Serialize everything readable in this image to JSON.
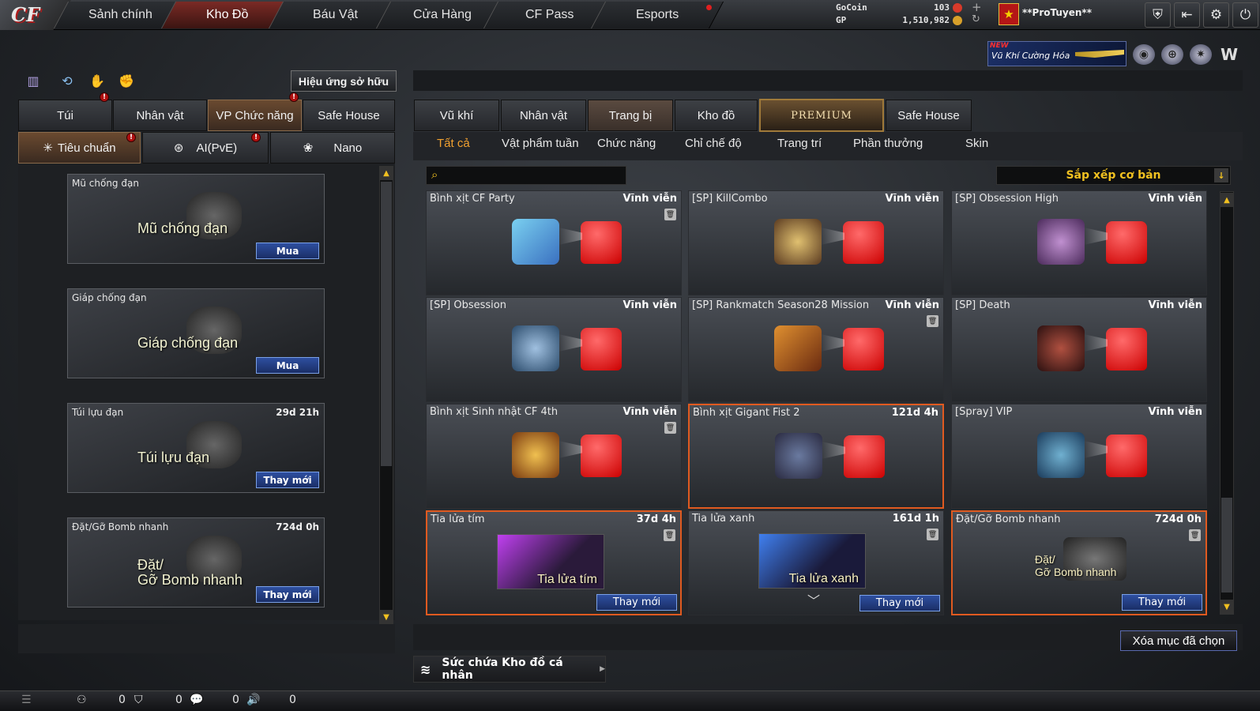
{
  "nav": {
    "tabs": [
      "Sảnh chính",
      "Kho Đồ",
      "Báu Vật",
      "Cửa Hàng",
      "CF Pass",
      "Esports"
    ],
    "active": "Kho Đồ"
  },
  "currency": {
    "gocoin_label": "GoCoin",
    "gocoin_value": "103",
    "gp_label": "GP",
    "gp_value": "1,510,982"
  },
  "player": {
    "name": "**ProTuyen**"
  },
  "banner": {
    "new": "NEW",
    "text": "Vũ Khí Cường Hóa"
  },
  "left": {
    "effect_button": "Hiệu ứng sở hữu",
    "tabs": [
      "Túi",
      "Nhân vật",
      "VP Chức năng",
      "Safe House"
    ],
    "subtabs": [
      "Tiêu chuẩn",
      "AI(PvE)",
      "Nano"
    ],
    "items": [
      {
        "name": "Mũ chống đạn",
        "time": "",
        "overlay": "Mũ chống đạn",
        "button": "Mua"
      },
      {
        "name": "Giáp chống đạn",
        "time": "",
        "overlay": "Giáp chống đạn",
        "button": "Mua"
      },
      {
        "name": "Túi lựu đạn",
        "time": "29d 21h",
        "overlay": "Túi lựu đạn",
        "button": "Thay mới"
      },
      {
        "name": "Đặt/Gỡ Bomb nhanh",
        "time": "724d 0h",
        "overlay1": "Đặt/",
        "overlay2": "Gỡ Bomb nhanh",
        "button": "Thay mới"
      }
    ]
  },
  "right": {
    "tabs": [
      "Vũ khí",
      "Nhân vật",
      "Trang bị",
      "Kho đồ",
      "PREMIUM",
      "Safe House"
    ],
    "subtabs": [
      "Tất cả",
      "Vật phẩm tuần",
      "Chức năng",
      "Chỉ chế độ",
      "Trang trí",
      "Phần thưởng",
      "Skin"
    ],
    "sort": "Sắp xếp cơ bản",
    "items": [
      {
        "name": "Bình xịt CF Party",
        "time": "Vĩnh viễn",
        "color": "#3aa0e0"
      },
      {
        "name": "[SP] KillCombo",
        "time": "Vĩnh viễn",
        "color": "#b08a40"
      },
      {
        "name": "[SP] Obsession High",
        "time": "Vĩnh viễn",
        "color": "#8a5aa0"
      },
      {
        "name": "[SP] Obsession",
        "time": "Vĩnh viễn",
        "color": "#5a8ac0"
      },
      {
        "name": "[SP] Rankmatch Season28 Mission",
        "time": "Vĩnh viễn",
        "color": "#c07020"
      },
      {
        "name": "[SP] Death",
        "time": "Vĩnh viễn",
        "color": "#7a3030"
      },
      {
        "name": "Bình xịt Sinh nhật CF 4th",
        "time": "Vĩnh viễn",
        "color": "#c09030"
      },
      {
        "name": "Bình xịt Gigant Fist 2",
        "time": "121d 4h",
        "color": "#4a5a8a"
      },
      {
        "name": "[Spray] VIP",
        "time": "Vĩnh viễn",
        "color": "#3a7aa0"
      },
      {
        "name": "Tia lửa tím",
        "time": "37d 4h",
        "overlay": "Tia lửa tím",
        "button": "Thay mới"
      },
      {
        "name": "Tia lửa xanh",
        "time": "161d 1h",
        "overlay": "Tia lửa xanh",
        "button": "Thay mới"
      },
      {
        "name": "Đặt/Gỡ Bomb nhanh",
        "time": "724d 0h",
        "overlay1": "Đặt/",
        "overlay2": "Gỡ Bomb nhanh",
        "button": "Thay mới"
      }
    ],
    "delete_button": "Xóa mục đã chọn",
    "capacity": "Sức chứa Kho đồ cá nhân"
  },
  "bottom": {
    "counts": [
      "0",
      "0",
      "0",
      "0"
    ]
  }
}
